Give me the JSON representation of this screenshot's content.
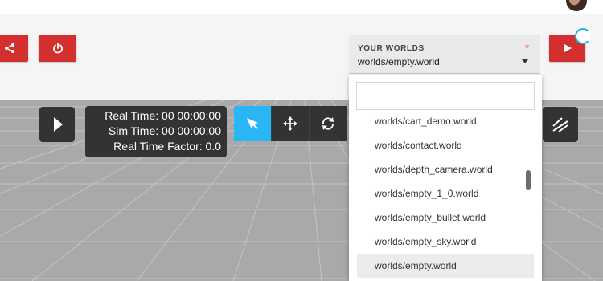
{
  "header": {
    "avatar_icon": "user-avatar-icon"
  },
  "toolbar": {
    "share_icon": "share-icon",
    "power_icon": "power-icon",
    "run_icon": "play-icon",
    "accent_color": "#d32f2f"
  },
  "worlds": {
    "label": "YOUR WORLDS",
    "required_mark": "*",
    "selected_value": "worlds/empty.world",
    "search_placeholder": "",
    "options": [
      "worlds/cart_demo.world",
      "worlds/contact.world",
      "worlds/depth_camera.world",
      "worlds/empty_1_0.world",
      "worlds/empty_bullet.world",
      "worlds/empty_sky.world",
      "worlds/empty.world"
    ]
  },
  "simulation": {
    "play_icon": "play-icon",
    "real_time": "Real Time: 00 00:00:00",
    "sim_time": "Sim Time: 00 00:00:00",
    "real_time_factor": "Real Time Factor: 0.0"
  },
  "tools": {
    "select_icon": "pointer-arrow-icon",
    "translate_icon": "move-arrows-icon",
    "rotate_icon": "rotate-icon",
    "lines_icon": "wireframe-lines-icon",
    "active_color": "#29b6f6"
  }
}
